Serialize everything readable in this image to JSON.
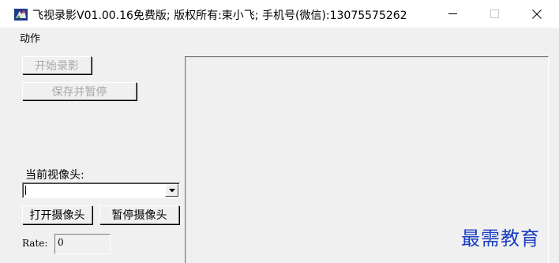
{
  "window": {
    "title": "飞视录影V01.00.16免费版; 版权所有:束小飞; 手机号(微信):13075575262"
  },
  "menu": {
    "items": [
      "动作"
    ]
  },
  "controls": {
    "start_record_label": "开始录影",
    "save_pause_label": "保存并暂停",
    "current_camera_label": "当前视像头:",
    "camera_selected": "",
    "open_camera_label": "打开摄像头",
    "pause_camera_label": "暂停摄像头",
    "rate_label": "Rate:",
    "rate_value": "0"
  },
  "watermark": {
    "text": "最需教育"
  },
  "colors": {
    "watermark": "#1a3cc4",
    "window_bg": "#f0f0f0"
  }
}
